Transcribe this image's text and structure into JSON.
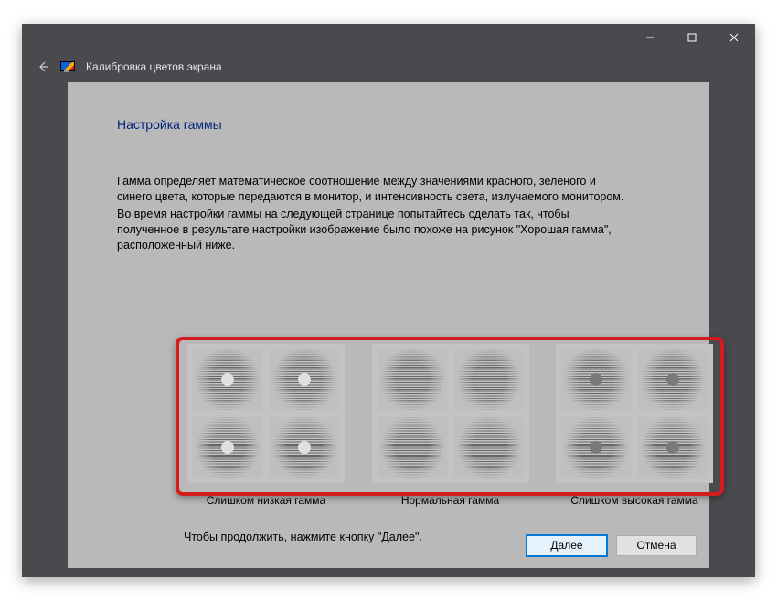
{
  "header": {
    "title": "Калибровка цветов экрана"
  },
  "page": {
    "title": "Настройка гаммы",
    "para1": "Гамма определяет математическое соотношение между значениями красного, зеленого и синего цвета, которые передаются в монитор, и интенсивность света, излучаемого монитором.",
    "para2": "Во время настройки гаммы на следующей странице попытайтесь сделать так, чтобы полученное в результате настройки изображение было похоже на рисунок \"Хорошая гамма\", расположенный ниже.",
    "continue": "Чтобы продолжить, нажмите кнопку \"Далее\"."
  },
  "samples": {
    "low": "Слишком низкая гамма",
    "normal": "Нормальная гамма",
    "high": "Слишком высокая гамма"
  },
  "buttons": {
    "next": "Далее",
    "cancel": "Отмена"
  }
}
